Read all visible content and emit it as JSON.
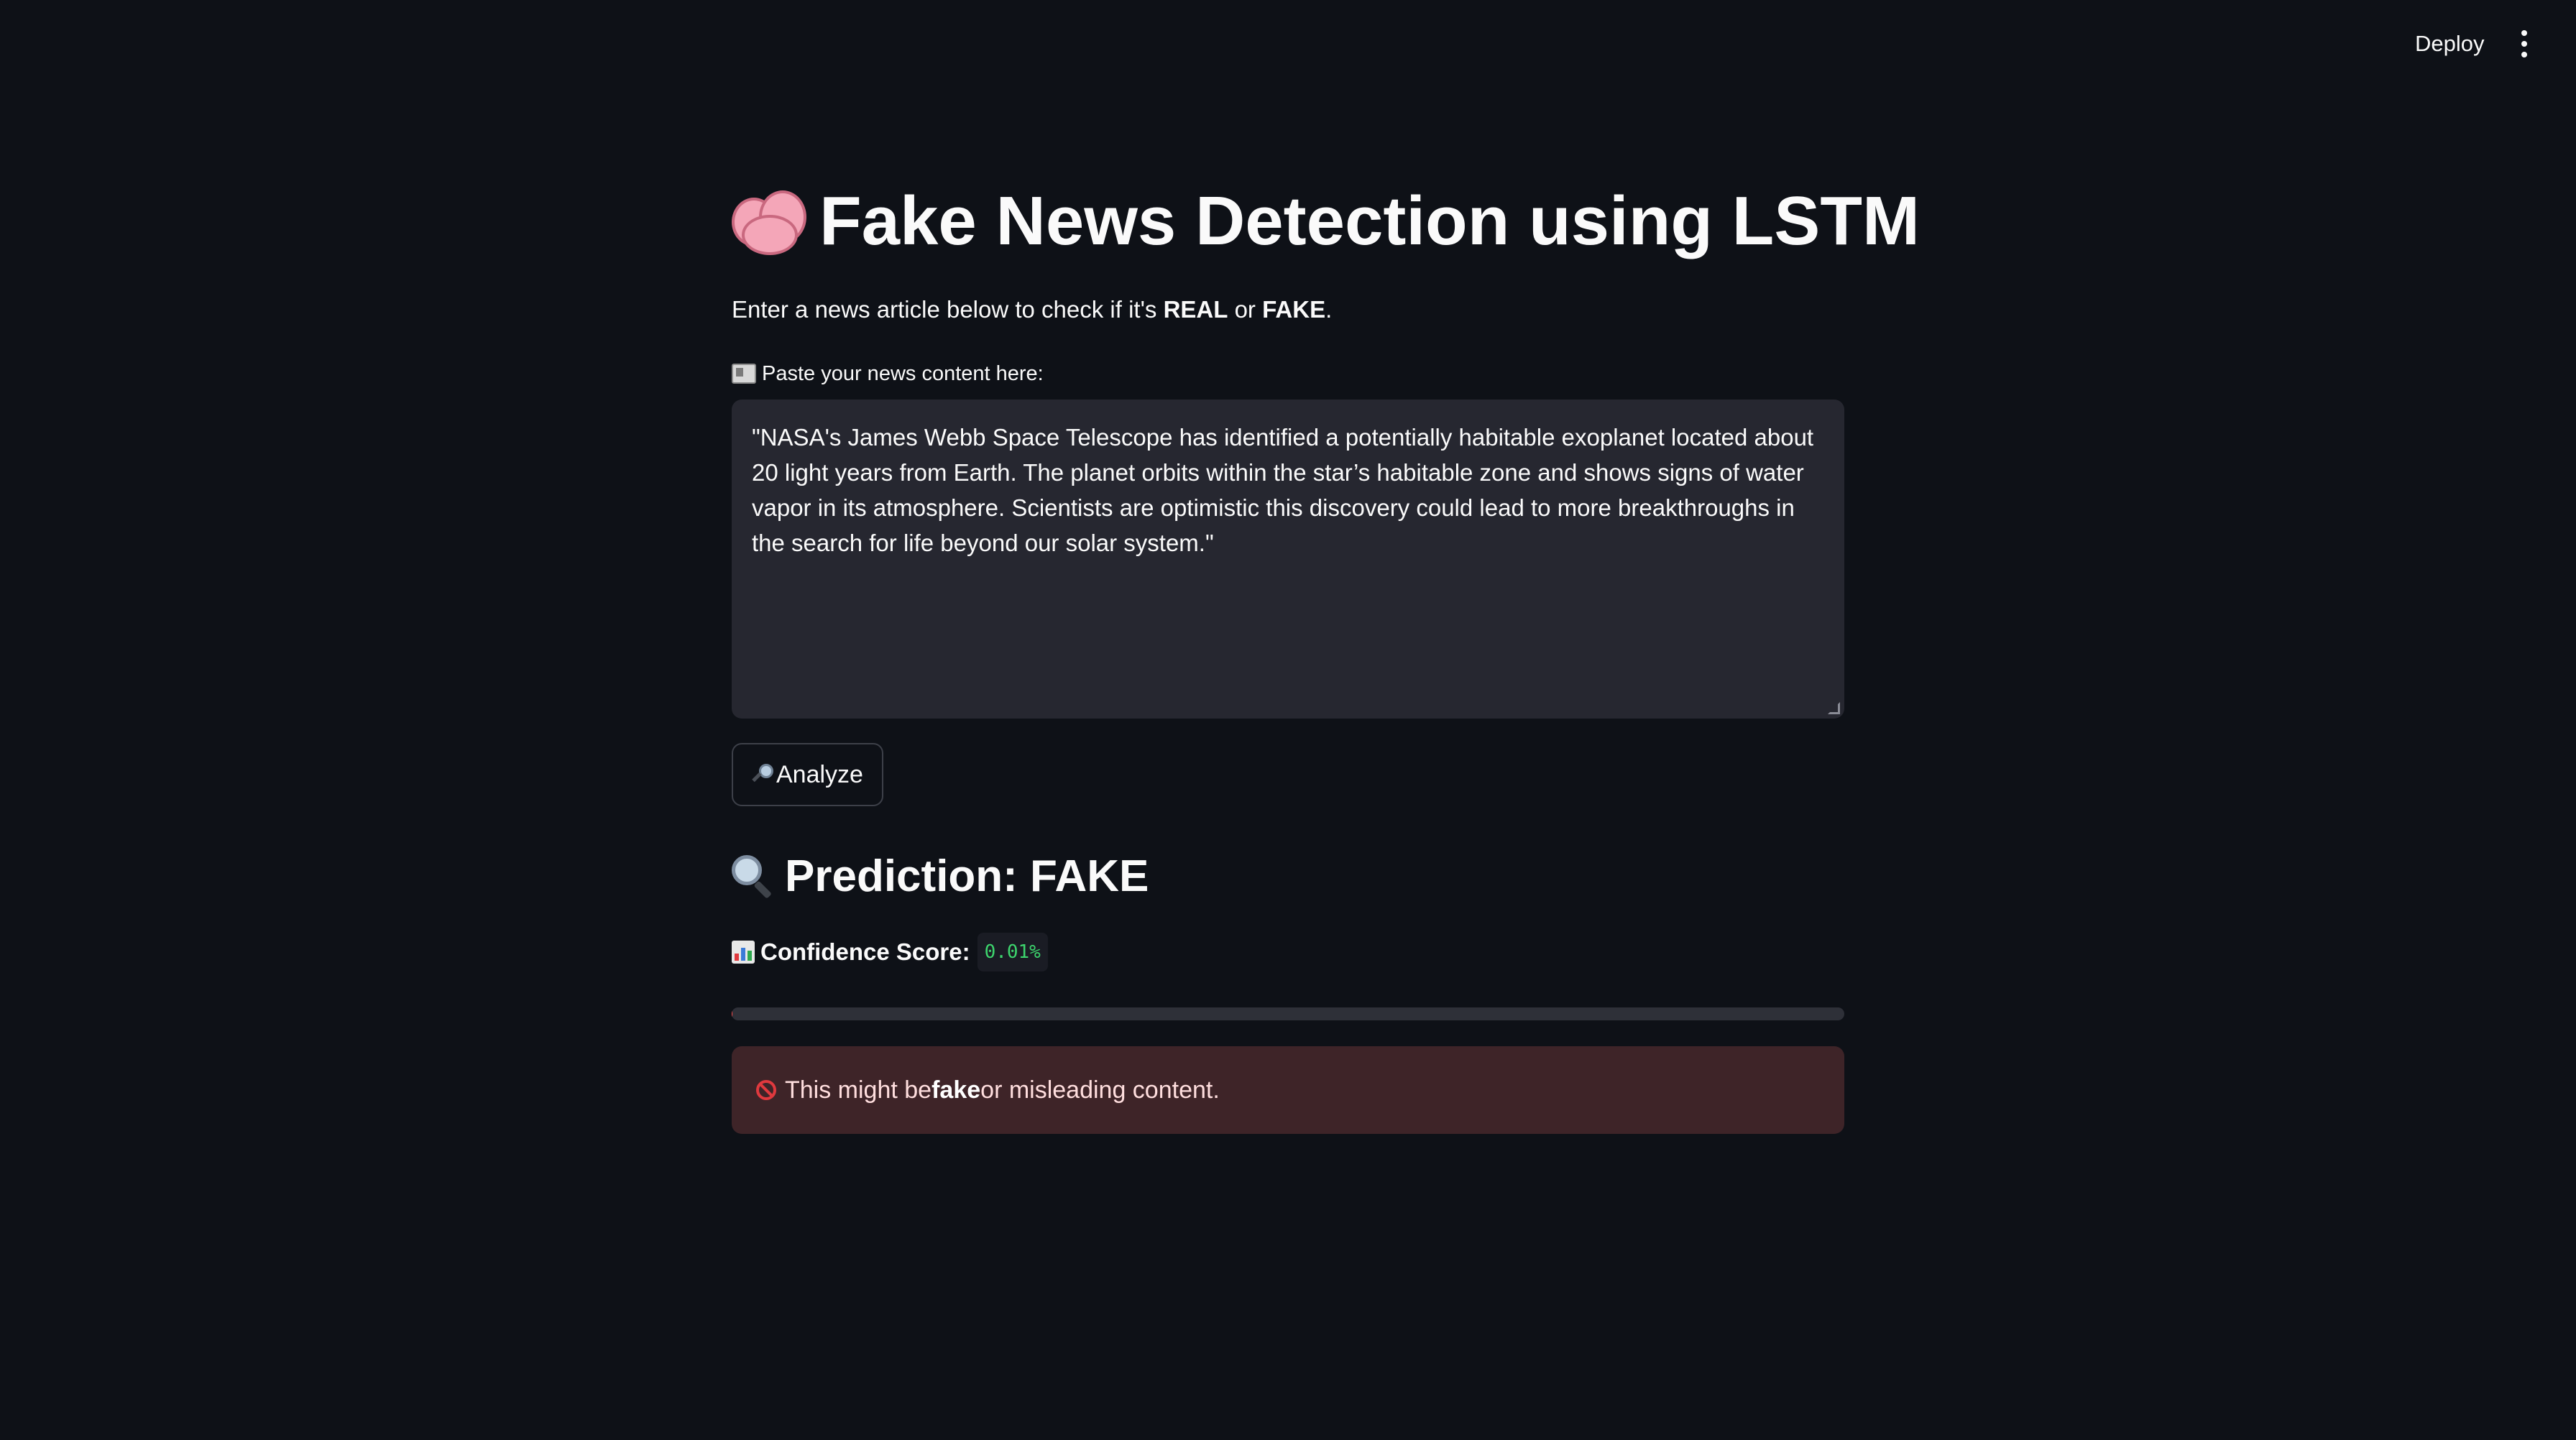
{
  "header": {
    "deploy_label": "Deploy",
    "menu_icon": "vertical-ellipsis-icon"
  },
  "main": {
    "title_icon": "brain-icon",
    "title": "Fake News Detection using LSTM",
    "subtitle_prefix": "Enter a news article below to check if it's ",
    "subtitle_real": "REAL",
    "subtitle_or": " or ",
    "subtitle_fake": "FAKE",
    "subtitle_suffix": ".",
    "input_label_icon": "newspaper-icon",
    "input_label": "Paste your news content here:",
    "input_value": "\"NASA's James Webb Space Telescope has identified a potentially habitable exoplanet located about 20 light years from Earth. The planet orbits within the star’s habitable zone and shows signs of water vapor in its atmosphere. Scientists are optimistic this discovery could lead to more breakthroughs in the search for life beyond our solar system.\"",
    "analyze_icon": "magnifier-icon",
    "analyze_label": "Analyze",
    "prediction_icon": "magnifier-icon",
    "prediction_label": "Prediction: FAKE",
    "confidence_icon": "bar-chart-icon",
    "confidence_label": "Confidence Score:",
    "confidence_value": "0.01%",
    "progress_fraction": 0.0001,
    "alert_icon": "no-entry-icon",
    "alert_prefix": "This might be ",
    "alert_bold": "fake",
    "alert_suffix": " or misleading content."
  },
  "colors": {
    "background": "#0e1117",
    "textarea_bg": "#262730",
    "alert_bg": "#3e2428",
    "code_green": "#3dd56d",
    "progress_red": "#ff4b4b"
  }
}
